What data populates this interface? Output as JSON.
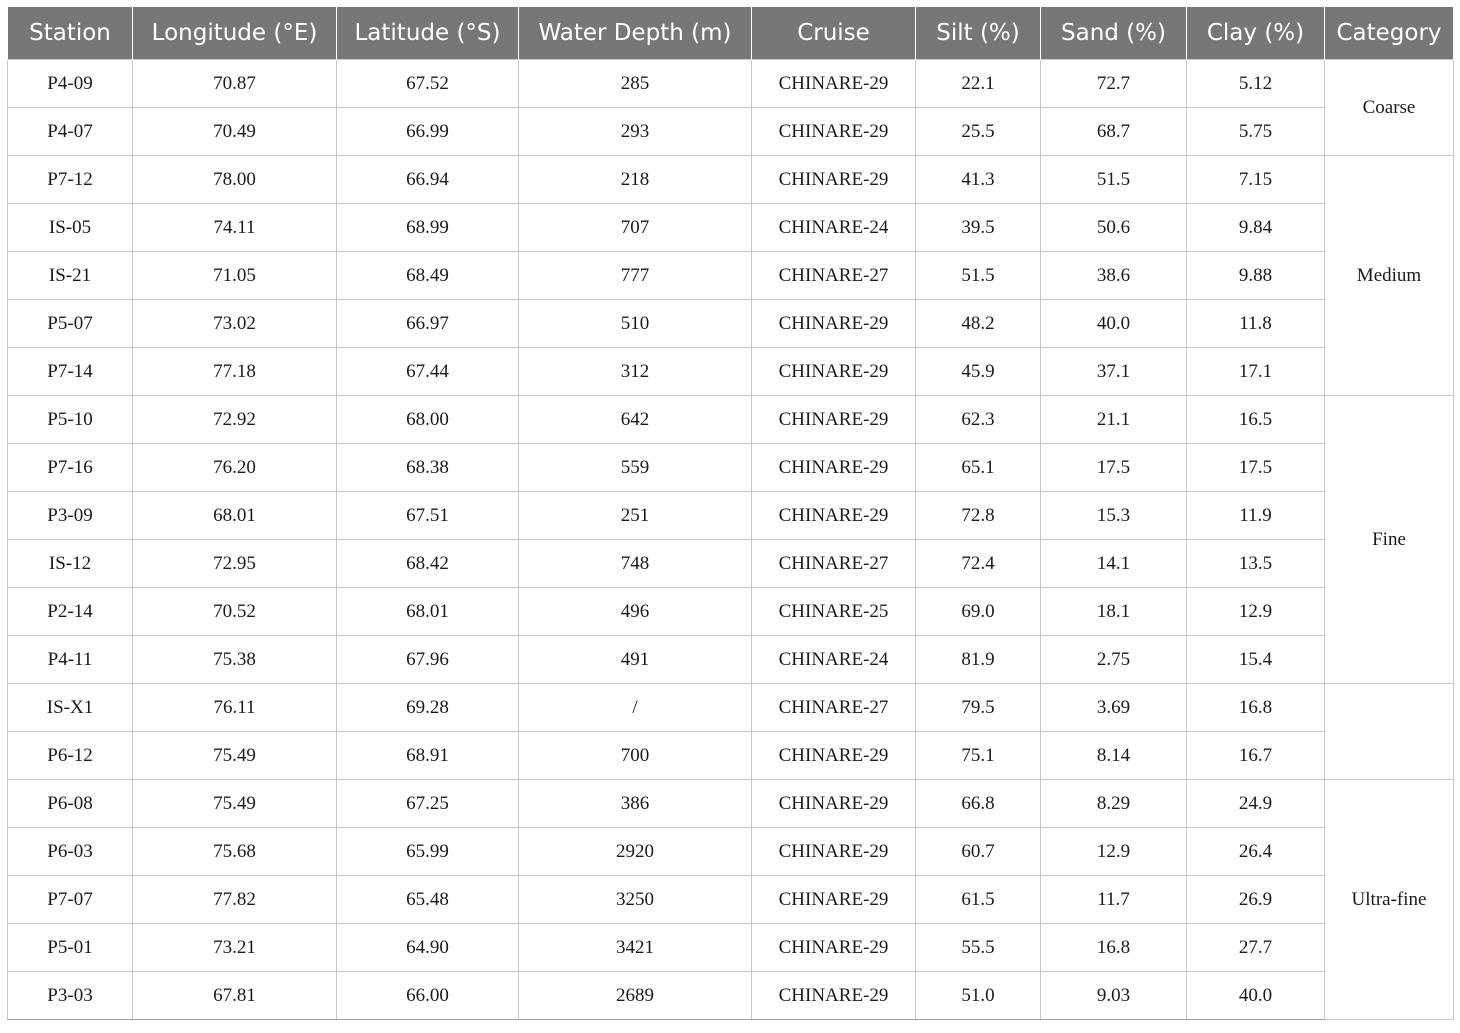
{
  "table": {
    "columns": [
      "Station",
      "Longitude (°E)",
      "Latitude (°S)",
      "Water Depth (m)",
      "Cruise",
      "Silt (%)",
      "Sand (%)",
      "Clay (%)",
      "Category"
    ],
    "rows": [
      [
        "P4-09",
        "70.87",
        "67.52",
        "285",
        "CHINARE-29",
        "22.1",
        "72.7",
        "5.12"
      ],
      [
        "P4-07",
        "70.49",
        "66.99",
        "293",
        "CHINARE-29",
        "25.5",
        "68.7",
        "5.75"
      ],
      [
        "P7-12",
        "78.00",
        "66.94",
        "218",
        "CHINARE-29",
        "41.3",
        "51.5",
        "7.15"
      ],
      [
        "IS-05",
        "74.11",
        "68.99",
        "707",
        "CHINARE-24",
        "39.5",
        "50.6",
        "9.84"
      ],
      [
        "IS-21",
        "71.05",
        "68.49",
        "777",
        "CHINARE-27",
        "51.5",
        "38.6",
        "9.88"
      ],
      [
        "P5-07",
        "73.02",
        "66.97",
        "510",
        "CHINARE-29",
        "48.2",
        "40.0",
        "11.8"
      ],
      [
        "P7-14",
        "77.18",
        "67.44",
        "312",
        "CHINARE-29",
        "45.9",
        "37.1",
        "17.1"
      ],
      [
        "P5-10",
        "72.92",
        "68.00",
        "642",
        "CHINARE-29",
        "62.3",
        "21.1",
        "16.5"
      ],
      [
        "P7-16",
        "76.20",
        "68.38",
        "559",
        "CHINARE-29",
        "65.1",
        "17.5",
        "17.5"
      ],
      [
        "P3-09",
        "68.01",
        "67.51",
        "251",
        "CHINARE-29",
        "72.8",
        "15.3",
        "11.9"
      ],
      [
        "IS-12",
        "72.95",
        "68.42",
        "748",
        "CHINARE-27",
        "72.4",
        "14.1",
        "13.5"
      ],
      [
        "P2-14",
        "70.52",
        "68.01",
        "496",
        "CHINARE-25",
        "69.0",
        "18.1",
        "12.9"
      ],
      [
        "P4-11",
        "75.38",
        "67.96",
        "491",
        "CHINARE-24",
        "81.9",
        "2.75",
        "15.4"
      ],
      [
        "IS-X1",
        "76.11",
        "69.28",
        "/",
        "CHINARE-27",
        "79.5",
        "3.69",
        "16.8"
      ],
      [
        "P6-12",
        "75.49",
        "68.91",
        "700",
        "CHINARE-29",
        "75.1",
        "8.14",
        "16.7"
      ],
      [
        "P6-08",
        "75.49",
        "67.25",
        "386",
        "CHINARE-29",
        "66.8",
        "8.29",
        "24.9"
      ],
      [
        "P6-03",
        "75.68",
        "65.99",
        "2920",
        "CHINARE-29",
        "60.7",
        "12.9",
        "26.4"
      ],
      [
        "P7-07",
        "77.82",
        "65.48",
        "3250",
        "CHINARE-29",
        "61.5",
        "11.7",
        "26.9"
      ],
      [
        "P5-01",
        "73.21",
        "64.90",
        "3421",
        "CHINARE-29",
        "55.5",
        "16.8",
        "27.7"
      ],
      [
        "P3-03",
        "67.81",
        "66.00",
        "2689",
        "CHINARE-29",
        "51.0",
        "9.03",
        "40.0"
      ]
    ],
    "categories": [
      {
        "label": "Coarse",
        "span": 2
      },
      {
        "label": "Medium",
        "span": 5
      },
      {
        "label": "Fine",
        "span": 6
      },
      {
        "label": "",
        "span": 2
      },
      {
        "label": "Ultra-fine",
        "span": 5
      }
    ]
  }
}
